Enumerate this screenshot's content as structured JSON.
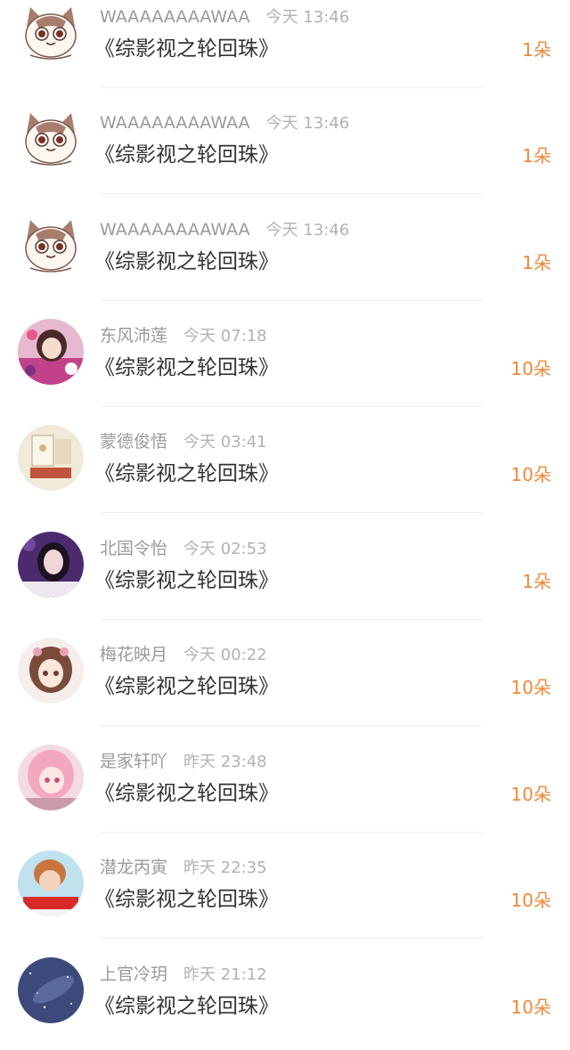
{
  "gifts": [
    {
      "user": "WAAAAAAAAWAA",
      "time": "今天 13:46",
      "book": "《综影视之轮回珠》",
      "count": "1朵",
      "avatar": "cat-avatar"
    },
    {
      "user": "WAAAAAAAAWAA",
      "time": "今天 13:46",
      "book": "《综影视之轮回珠》",
      "count": "1朵",
      "avatar": "cat-avatar"
    },
    {
      "user": "WAAAAAAAAWAA",
      "time": "今天 13:46",
      "book": "《综影视之轮回珠》",
      "count": "1朵",
      "avatar": "cat-avatar"
    },
    {
      "user": "东风沛莲",
      "time": "今天 07:18",
      "book": "《综影视之轮回珠》",
      "count": "10朵",
      "avatar": "anime-girl-avatar"
    },
    {
      "user": "蒙德俊悟",
      "time": "今天 03:41",
      "book": "《综影视之轮回珠》",
      "count": "10朵",
      "avatar": "cake-avatar"
    },
    {
      "user": "北国令怡",
      "time": "今天 02:53",
      "book": "《综影视之轮回珠》",
      "count": "1朵",
      "avatar": "girl-photo-avatar"
    },
    {
      "user": "梅花映月",
      "time": "今天 00:22",
      "book": "《综影视之轮回珠》",
      "count": "10朵",
      "avatar": "doll-avatar"
    },
    {
      "user": "是家轩吖",
      "time": "昨天 23:48",
      "book": "《综影视之轮回珠》",
      "count": "10朵",
      "avatar": "pink-hair-avatar"
    },
    {
      "user": "潜龙丙寅",
      "time": "昨天 22:35",
      "book": "《综影视之轮回珠》",
      "count": "10朵",
      "avatar": "boy-avatar"
    },
    {
      "user": "上官冷玥",
      "time": "昨天 21:12",
      "book": "《综影视之轮回珠》",
      "count": "10朵",
      "avatar": "galaxy-avatar"
    }
  ],
  "colors": {
    "count": "#f0883a",
    "name": "#9a9a9a",
    "book": "#333333"
  }
}
